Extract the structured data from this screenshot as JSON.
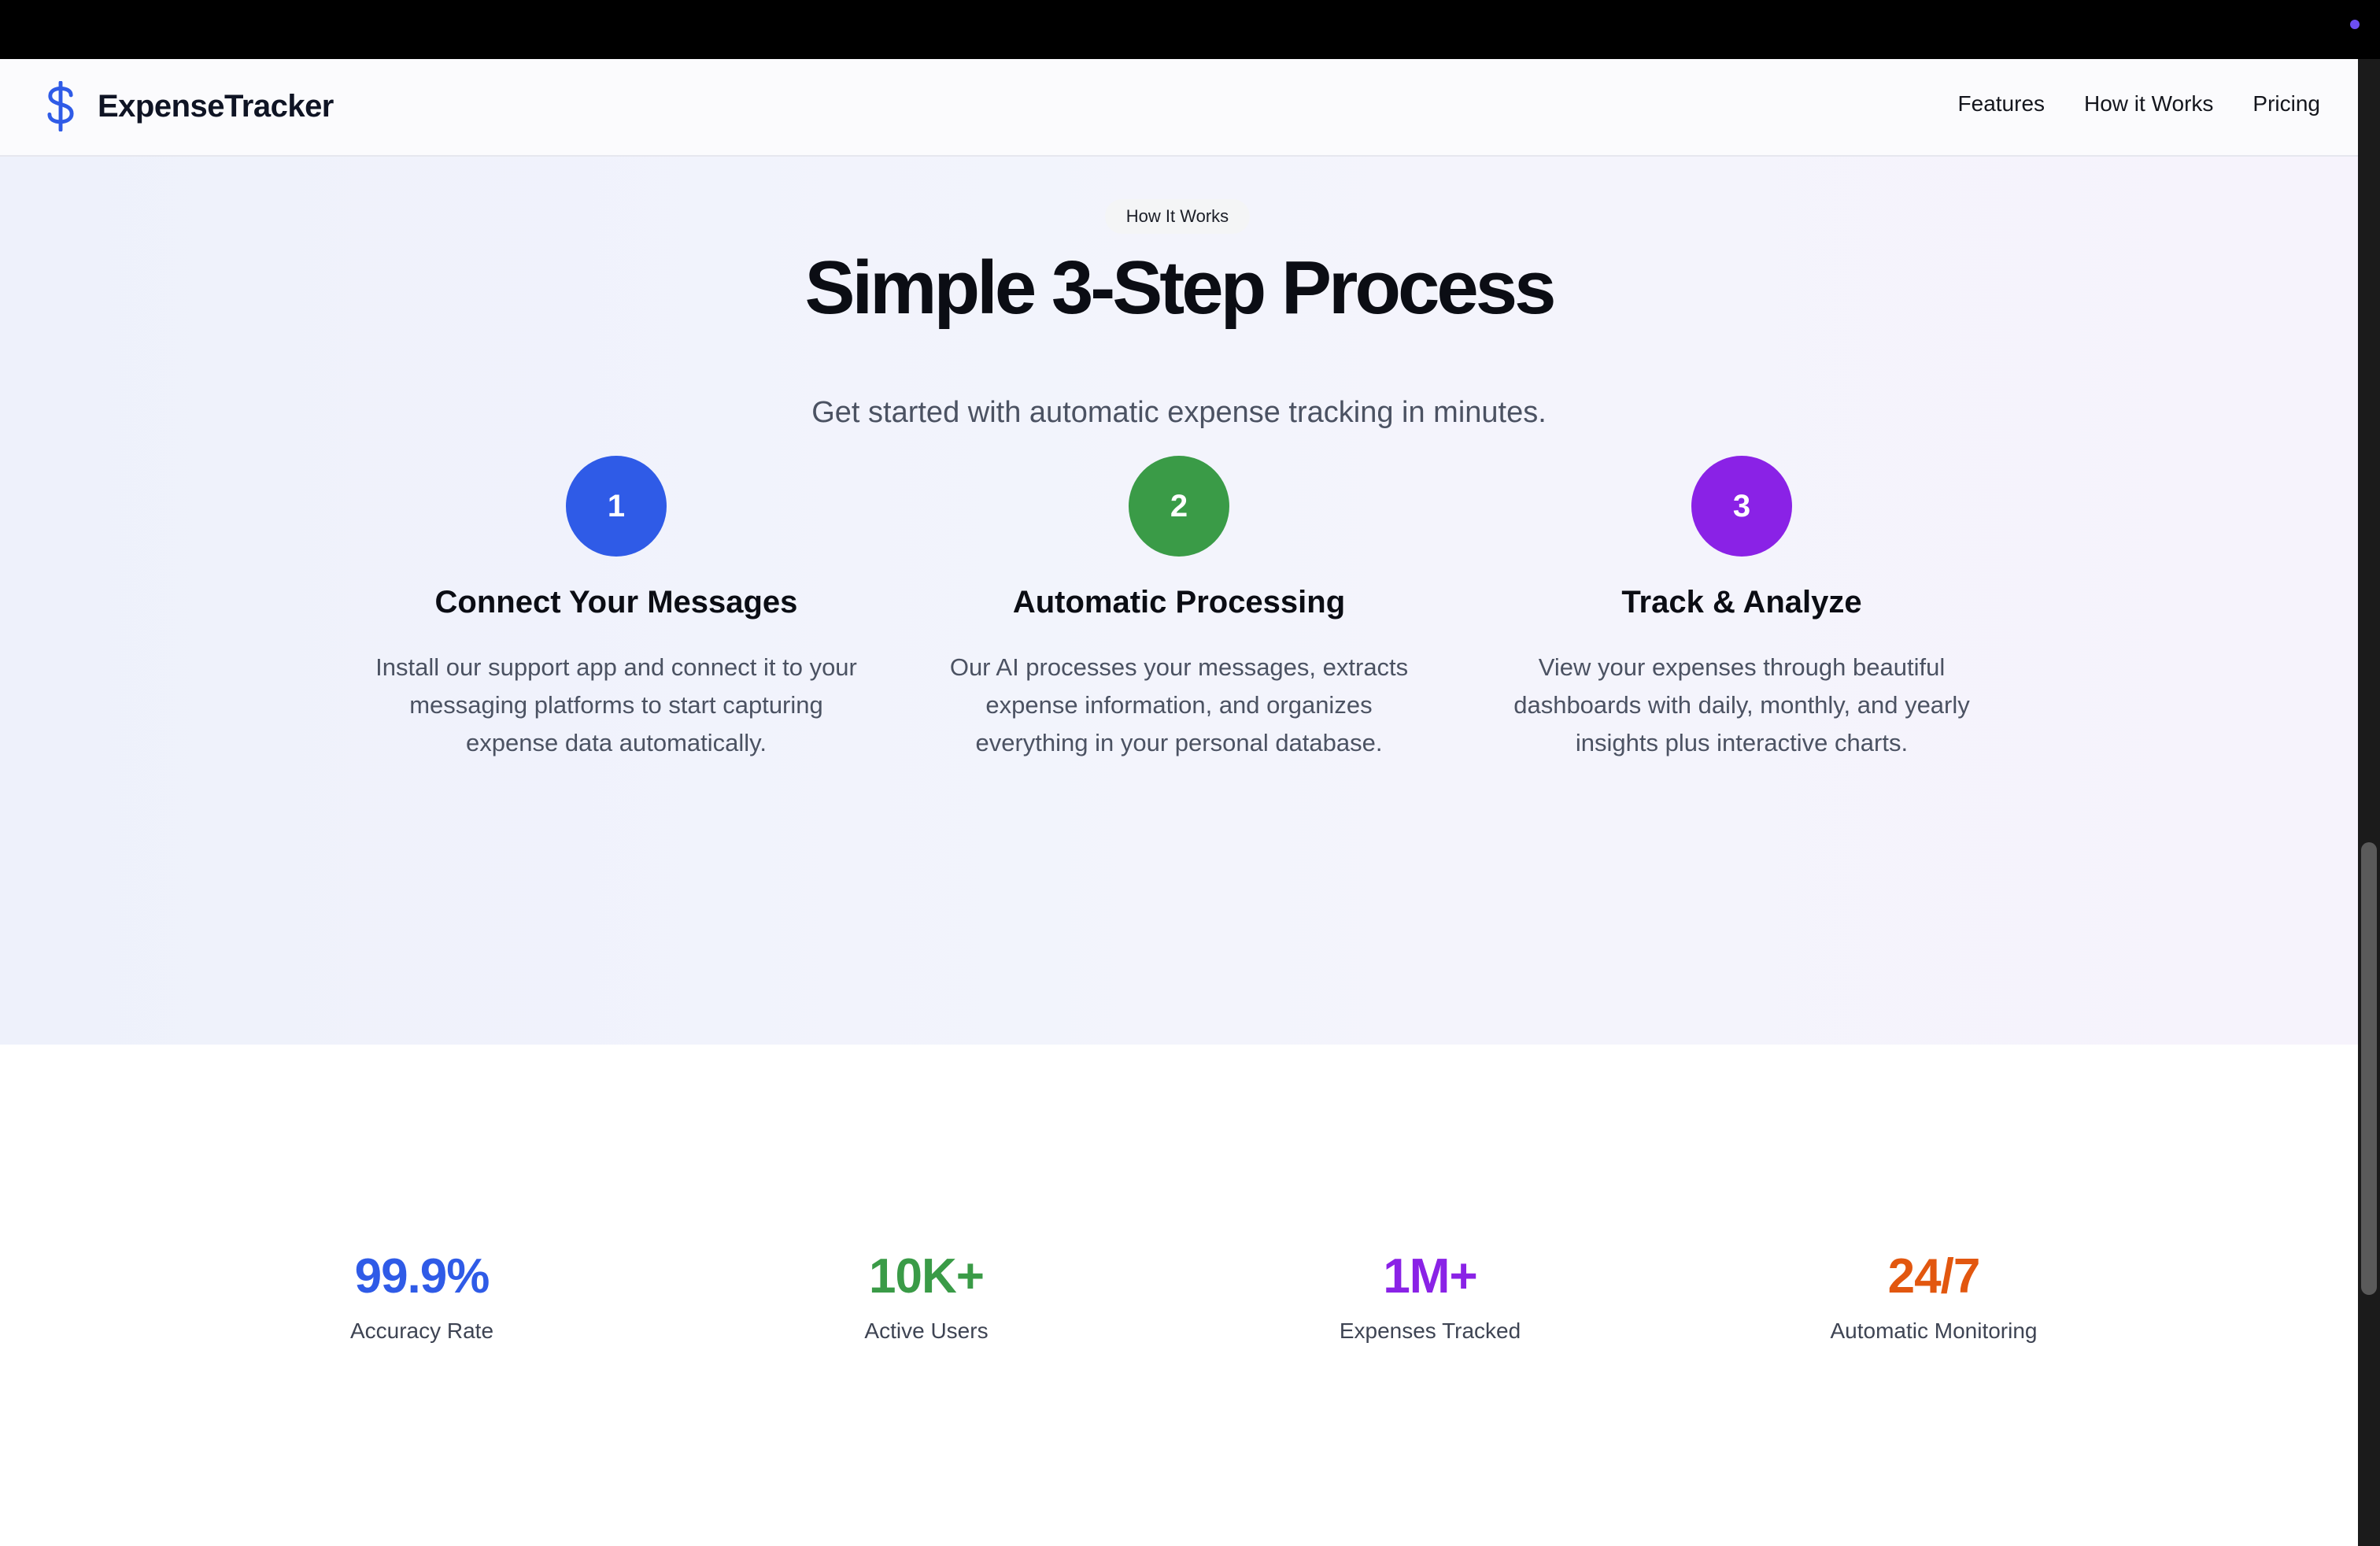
{
  "brand": {
    "name": "ExpenseTracker",
    "icon": "dollar-sign-icon",
    "color": "#2f5be7"
  },
  "nav": {
    "links": [
      "Features",
      "How it Works",
      "Pricing"
    ]
  },
  "how_it_works": {
    "badge": "How It Works",
    "title": "Simple 3-Step Process",
    "subtitle": "Get started with automatic expense tracking in minutes.",
    "steps": [
      {
        "number": "1",
        "title": "Connect Your Messages",
        "description": "Install our support app and connect it to your messaging platforms to start capturing expense data automatically.",
        "color": "#2f5be7"
      },
      {
        "number": "2",
        "title": "Automatic Processing",
        "description": "Our AI processes your messages, extracts expense information, and organizes everything in your personal database.",
        "color": "#3a9b47"
      },
      {
        "number": "3",
        "title": "Track & Analyze",
        "description": "View your expenses through beautiful dashboards with daily, monthly, and yearly insights plus interactive charts.",
        "color": "#8a22e6"
      }
    ]
  },
  "stats": [
    {
      "value": "99.9%",
      "label": "Accuracy Rate",
      "color": "#2f5be7"
    },
    {
      "value": "10K+",
      "label": "Active Users",
      "color": "#3a9b47"
    },
    {
      "value": "1M+",
      "label": "Expenses Tracked",
      "color": "#8a22e6"
    },
    {
      "value": "24/7",
      "label": "Automatic Monitoring",
      "color": "#e2570f"
    }
  ]
}
